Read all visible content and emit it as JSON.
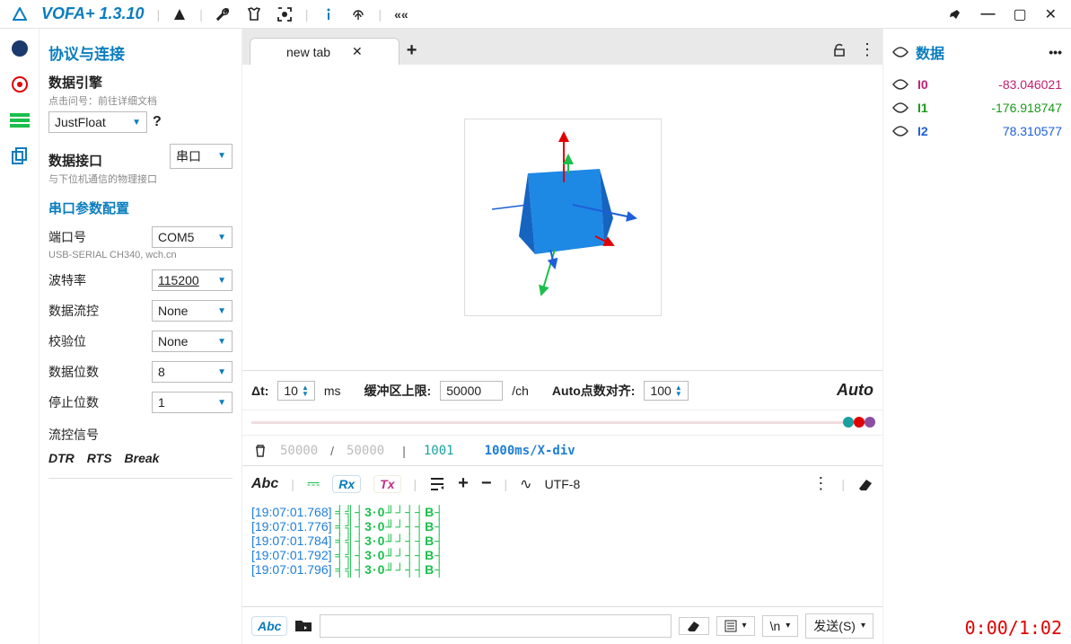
{
  "app": {
    "title": "VOFA+ 1.3.10"
  },
  "left": {
    "header": "协议与连接",
    "engine_label": "数据引擎",
    "engine_sub": "点击问号：前往详细文档",
    "engine_value": "JustFloat",
    "engine_help": "?",
    "iface_label": "数据接口",
    "iface_value": "串口",
    "iface_sub": "与下位机通信的物理接口",
    "serial_header": "串口参数配置",
    "port_label": "端口号",
    "port_value": "COM5",
    "port_sub": "USB-SERIAL CH340, wch.cn",
    "baud_label": "波特率",
    "baud_value": "115200",
    "flow_label": "数据流控",
    "flow_value": "None",
    "parity_label": "校验位",
    "parity_value": "None",
    "databits_label": "数据位数",
    "databits_value": "8",
    "stopbits_label": "停止位数",
    "stopbits_value": "1",
    "signal_label": "流控信号",
    "sig_dtr": "DTR",
    "sig_rts": "RTS",
    "sig_break": "Break"
  },
  "tabs": {
    "name": "new tab"
  },
  "databar": {
    "dt": "Δt:",
    "dt_val": "10",
    "dt_unit": "ms",
    "buf": "缓冲区上限:",
    "buf_val": "50000",
    "buf_unit": "/ch",
    "align": "Auto点数对齐:",
    "align_val": "100",
    "auto": "Auto"
  },
  "status": {
    "a": "50000",
    "sep": "/",
    "b": "50000",
    "bar": "|",
    "c": "1001",
    "d": "1000ms/X-div"
  },
  "console": {
    "abc": "Abc",
    "rx": "Rx",
    "tx": "Tx",
    "encoding": "UTF-8",
    "lines": [
      {
        "ts": "[19:07:01.768]",
        "pl": "╡╣┤3·0╜┘┤┤B┤"
      },
      {
        "ts": "[19:07:01.776]",
        "pl": "╡╣┤3·0╜┘┤┤B┤"
      },
      {
        "ts": "[19:07:01.784]",
        "pl": "╡╣┤3·0╜┘┤┤B┤"
      },
      {
        "ts": "[19:07:01.792]",
        "pl": "╡╣┤3·0╜┘┤┤B┤"
      },
      {
        "ts": "[19:07:01.796]",
        "pl": "╡╣┤3·0╜┘┤┤B┤"
      }
    ]
  },
  "send": {
    "abc": "Abc",
    "nl": "\\n",
    "btn": "发送(S)"
  },
  "right": {
    "title": "数据",
    "rows": [
      {
        "name": "I0",
        "value": "-83.046021",
        "color": "#c02070"
      },
      {
        "name": "I1",
        "value": "-176.918747",
        "color": "#1a9a1a"
      },
      {
        "name": "I2",
        "value": "78.310577",
        "color": "#1e5fd8"
      }
    ]
  },
  "timer": "0:00/1:02"
}
